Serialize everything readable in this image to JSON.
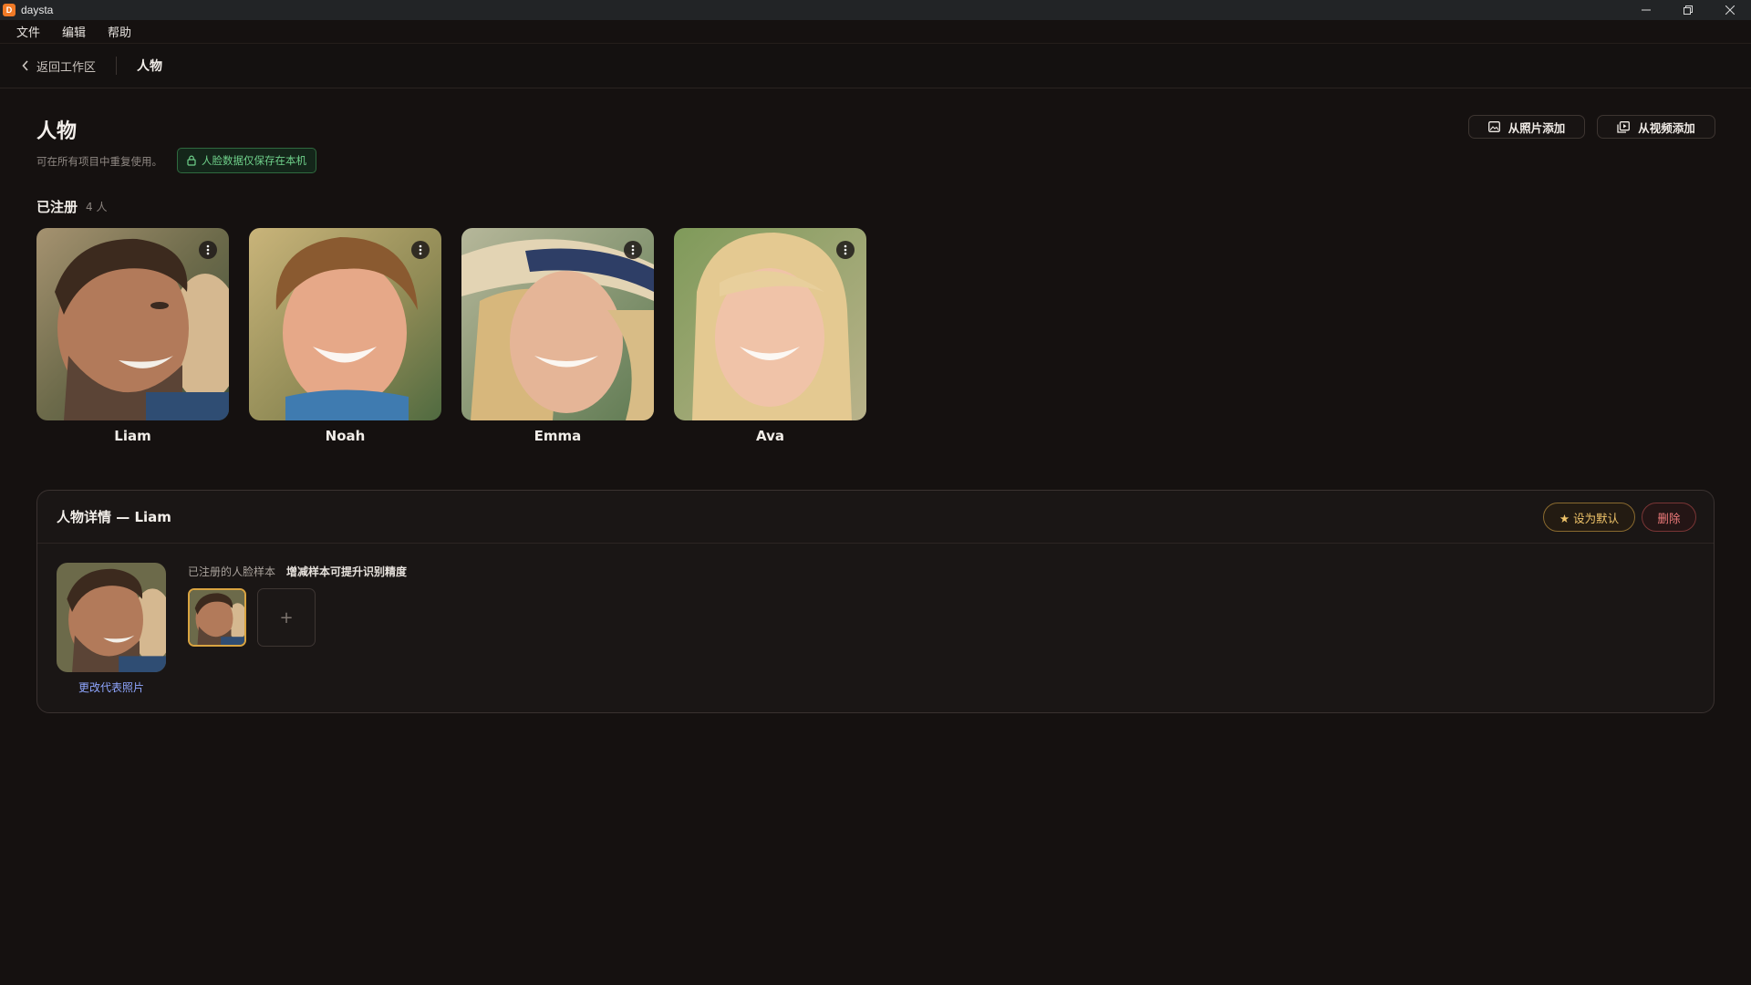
{
  "window": {
    "title": "daysta",
    "app_icon_letter": "D"
  },
  "menu": {
    "items": [
      "文件",
      "编辑",
      "帮助"
    ]
  },
  "toolbar": {
    "back_label": "返回工作区",
    "title": "人物"
  },
  "header": {
    "title": "人物",
    "subtitle": "可在所有项目中重复使用。",
    "privacy_badge": "人脸数据仅保存在本机",
    "add_from_photo": "从照片添加",
    "add_from_video": "从视频添加"
  },
  "registered": {
    "title": "已注册",
    "count": "4 人",
    "people": [
      {
        "name": "Liam"
      },
      {
        "name": "Noah"
      },
      {
        "name": "Emma"
      },
      {
        "name": "Ava"
      }
    ]
  },
  "detail": {
    "title": "人物详情 — Liam",
    "set_default": "★ 设为默认",
    "delete": "删除",
    "change_photo": "更改代表照片",
    "samples_label": "已注册的人脸样本",
    "samples_hint": "增减样本可提升识别精度",
    "add_sample": "+"
  },
  "colors": {
    "background": "#151110",
    "accent_gold": "#d9a441",
    "privacy_green": "#6fd08a",
    "danger_red": "#ee7a7a",
    "link_blue": "#8fa6ff"
  }
}
